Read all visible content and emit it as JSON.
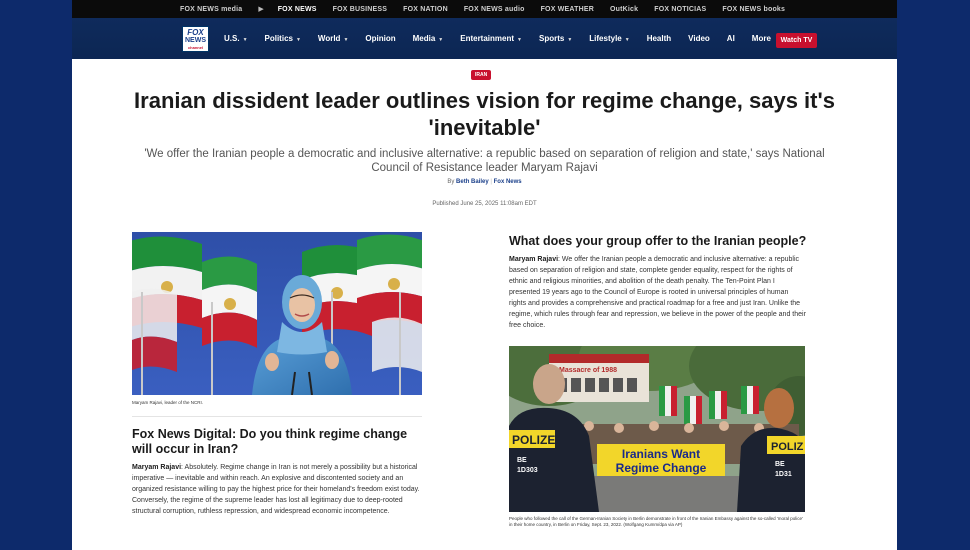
{
  "network_bar": {
    "items": [
      {
        "label": "FOX NEWS media",
        "active": false
      },
      {
        "label": "FOX NEWS",
        "active": true
      },
      {
        "label": "FOX BUSINESS",
        "active": false
      },
      {
        "label": "FOX NATION",
        "active": false
      },
      {
        "label": "FOX NEWS audio",
        "active": false
      },
      {
        "label": "FOX WEATHER",
        "active": false
      },
      {
        "label": "OutKick",
        "active": false
      },
      {
        "label": "FOX NOTICIAS",
        "active": false
      },
      {
        "label": "FOX NEWS books",
        "active": false
      }
    ]
  },
  "nav": {
    "logo": {
      "line1": "FOX",
      "line2": "NEWS",
      "line3": "channel"
    },
    "items": [
      {
        "label": "U.S.",
        "caret": true
      },
      {
        "label": "Politics",
        "caret": true
      },
      {
        "label": "World",
        "caret": true
      },
      {
        "label": "Opinion",
        "caret": false
      },
      {
        "label": "Media",
        "caret": true
      },
      {
        "label": "Entertainment",
        "caret": true
      },
      {
        "label": "Sports",
        "caret": true
      },
      {
        "label": "Lifestyle",
        "caret": true
      },
      {
        "label": "Health",
        "caret": false
      },
      {
        "label": "Video",
        "caret": false
      },
      {
        "label": "AI",
        "caret": false
      },
      {
        "label": "More",
        "caret": false,
        "dots": "⋮"
      }
    ],
    "watch_tv": "Watch TV"
  },
  "article": {
    "category": "IRAN",
    "headline": "Iranian dissident leader outlines vision for regime change, says it's 'inevitable'",
    "dek": "'We offer the Iranian people a democratic and inclusive alternative: a republic based on separation of religion and state,' says National Council of Resistance leader Maryam Rajavi",
    "byline_prefix": "By",
    "author": "Beth Bailey",
    "byline_sep": "|",
    "outlet": "Fox News",
    "published": "Published June 25, 2025 11:08am EDT",
    "photo1_caption": "Maryam Rajavi, leader of the NCRI.",
    "q1_heading": "Fox News Digital: Do you think regime change will occur in Iran?",
    "q1_speaker": "Maryam Rajavi",
    "q1_answer": ": Absolutely. Regime change in Iran is not merely a possibility but a historical imperative — inevitable and within reach. An explosive and discontented society and an organized resistance willing to pay the highest price for their homeland's freedom exist today. Conversely, the regime of the supreme leader has lost all legitimacy due to deep-rooted structural corruption, ruthless repression, and widespread economic incompetence.",
    "q2_heading": "What does your group offer to the Iranian people?",
    "q2_speaker": "Maryam Rajavi",
    "q2_answer": ": We offer the Iranian people a democratic and inclusive alternative: a republic based on separation of religion and state, complete gender equality, respect for the rights of ethnic and religious minorities, and abolition of the death penalty. The Ten-Point Plan I presented 19 years ago to the Council of Europe is rooted in universal principles of human rights and provides a comprehensive and practical roadmap for a free and just Iran. Unlike the regime, which rules through fear and repression, we believe in the power of the people and their free choice.",
    "photo2_sign": "Iranians Want Regime Change",
    "photo2_banner": "Massacre of 1988",
    "photo2_police_left": "POLIZEI",
    "photo2_police_right": "POLIZ",
    "photo2_plate_left": "BE 1D303",
    "photo2_plate_right": "BE 1D31",
    "photo2_caption": "People who followed the call of the German-Iranian Society in Berlin demonstrate in front of the Iranian Embassy against the so-called 'moral police' in their home country, in Berlin on Friday, Sept. 23, 2022.  (Wolfgang Kumm/dpa via AP)"
  },
  "colors": {
    "page_bg": "#0d2a6b",
    "nav_bg": "#0c2653",
    "accent_red": "#c8102e",
    "link_blue": "#1a3f8a"
  }
}
